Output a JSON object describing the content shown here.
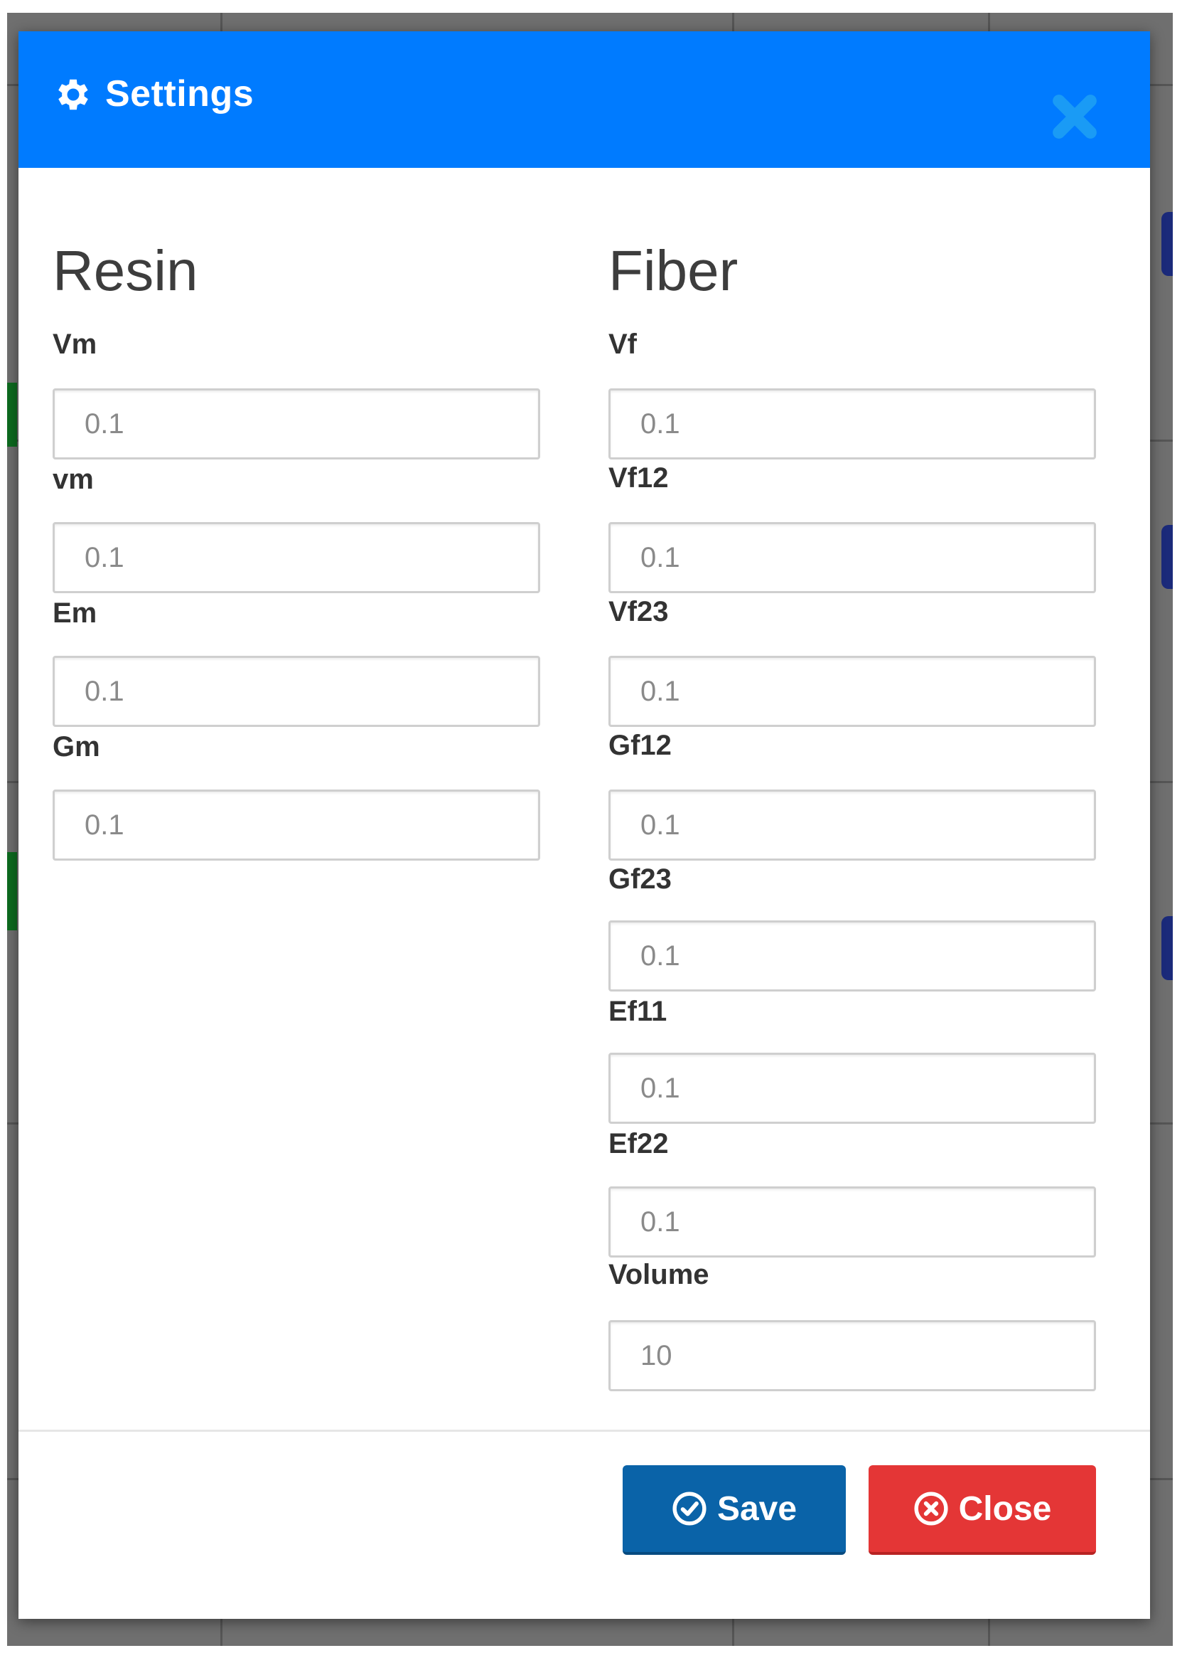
{
  "colors": {
    "header": "#007bff",
    "save_button": "#0a63a8",
    "close_button": "#e43636",
    "close_icon": "#1a9bf5"
  },
  "modal": {
    "title": "Settings",
    "title_icon": "gear-icon",
    "close_icon": "close-icon"
  },
  "resin": {
    "title": "Resin",
    "fields": [
      {
        "label": "Vm",
        "value": "0.1"
      },
      {
        "label": "vm",
        "value": "0.1"
      },
      {
        "label": "Em",
        "value": "0.1"
      },
      {
        "label": "Gm",
        "value": "0.1"
      }
    ]
  },
  "fiber": {
    "title": "Fiber",
    "fields": [
      {
        "label": "Vf",
        "value": "0.1"
      },
      {
        "label": "Vf12",
        "value": "0.1"
      },
      {
        "label": "Vf23",
        "value": "0.1"
      },
      {
        "label": "Gf12",
        "value": "0.1"
      },
      {
        "label": "Gf23",
        "value": "0.1"
      },
      {
        "label": "Ef11",
        "value": "0.1"
      },
      {
        "label": "Ef22",
        "value": "0.1"
      },
      {
        "label": "Volume",
        "value": "10"
      }
    ]
  },
  "footer": {
    "save_label": "Save",
    "save_icon": "check-circle-icon",
    "close_label": "Close",
    "close_icon": "times-circle-icon"
  }
}
